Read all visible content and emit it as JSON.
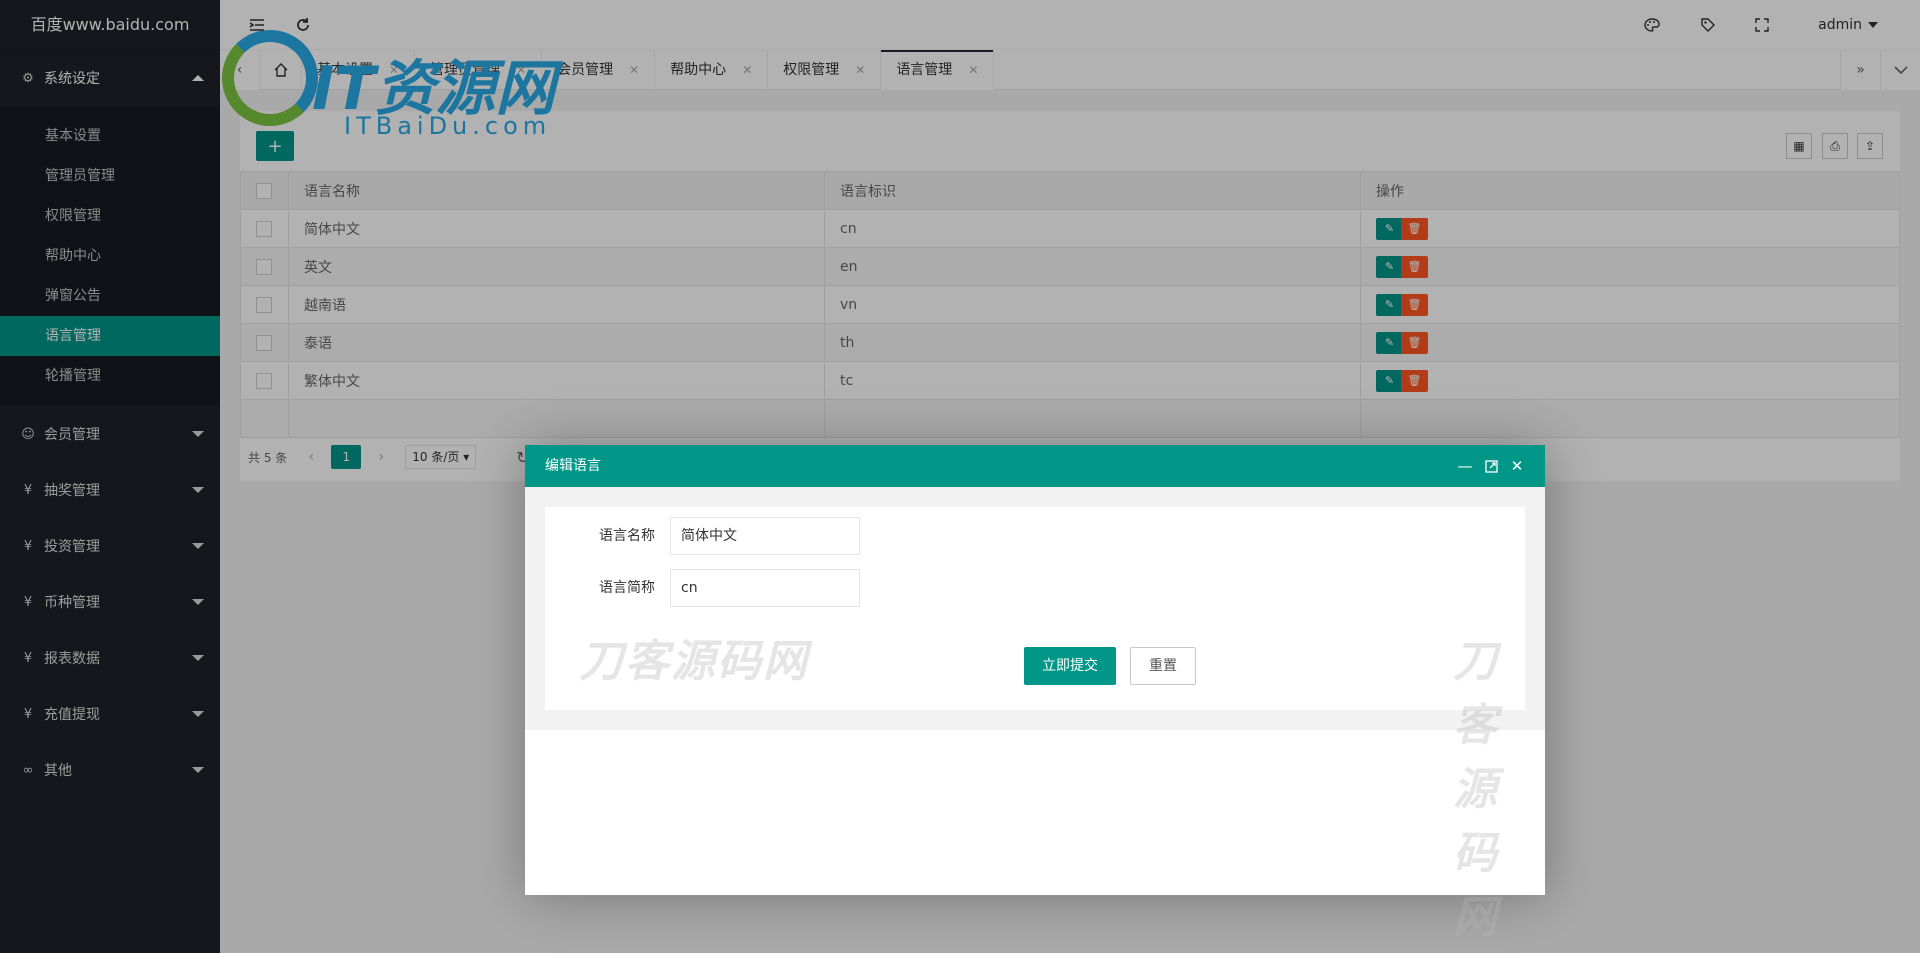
{
  "sidebar": {
    "logo": "百度www.baidu.com",
    "groups": [
      {
        "label": "系统设定",
        "icon": "gear-icon"
      },
      {
        "label": "会员管理",
        "icon": "user-icon"
      },
      {
        "label": "抽奖管理",
        "icon": "yen-icon"
      },
      {
        "label": "投资管理",
        "icon": "yen-icon"
      },
      {
        "label": "币种管理",
        "icon": "yen-icon"
      },
      {
        "label": "报表数据",
        "icon": "yen-icon"
      },
      {
        "label": "充值提现",
        "icon": "yen-icon"
      },
      {
        "label": "其他",
        "icon": "link-icon"
      }
    ],
    "sub_items": [
      "基本设置",
      "管理员管理",
      "权限管理",
      "帮助中心",
      "弹窗公告",
      "语言管理",
      "轮播管理"
    ]
  },
  "header": {
    "user": "admin"
  },
  "tabs": [
    {
      "label": "基本设置"
    },
    {
      "label": "管理员管理"
    },
    {
      "label": "会员管理"
    },
    {
      "label": "帮助中心"
    },
    {
      "label": "权限管理"
    },
    {
      "label": "语言管理"
    }
  ],
  "table": {
    "add_label": "+",
    "columns": [
      "语言名称",
      "语言标识",
      "操作"
    ],
    "rows": [
      {
        "name": "简体中文",
        "code": "cn"
      },
      {
        "name": "英文",
        "code": "en"
      },
      {
        "name": "越南语",
        "code": "vn"
      },
      {
        "name": "泰语",
        "code": "th"
      },
      {
        "name": "繁体中文",
        "code": "tc"
      }
    ]
  },
  "pager": {
    "total": "共 5 条",
    "current": "1",
    "page_size": "10 条/页"
  },
  "modal": {
    "title": "编辑语言",
    "fields": [
      {
        "label": "语言名称",
        "value": "简体中文"
      },
      {
        "label": "语言简称",
        "value": "cn"
      }
    ],
    "submit_label": "立即提交",
    "reset_label": "重置"
  },
  "watermarks": {
    "logo_big": "IT资源网",
    "logo_small": "ITBaiDu.com",
    "text": "刀客源码网"
  },
  "colors": {
    "accent": "#009688",
    "danger": "#ff5722",
    "sidebar_bg": "#20222a"
  }
}
